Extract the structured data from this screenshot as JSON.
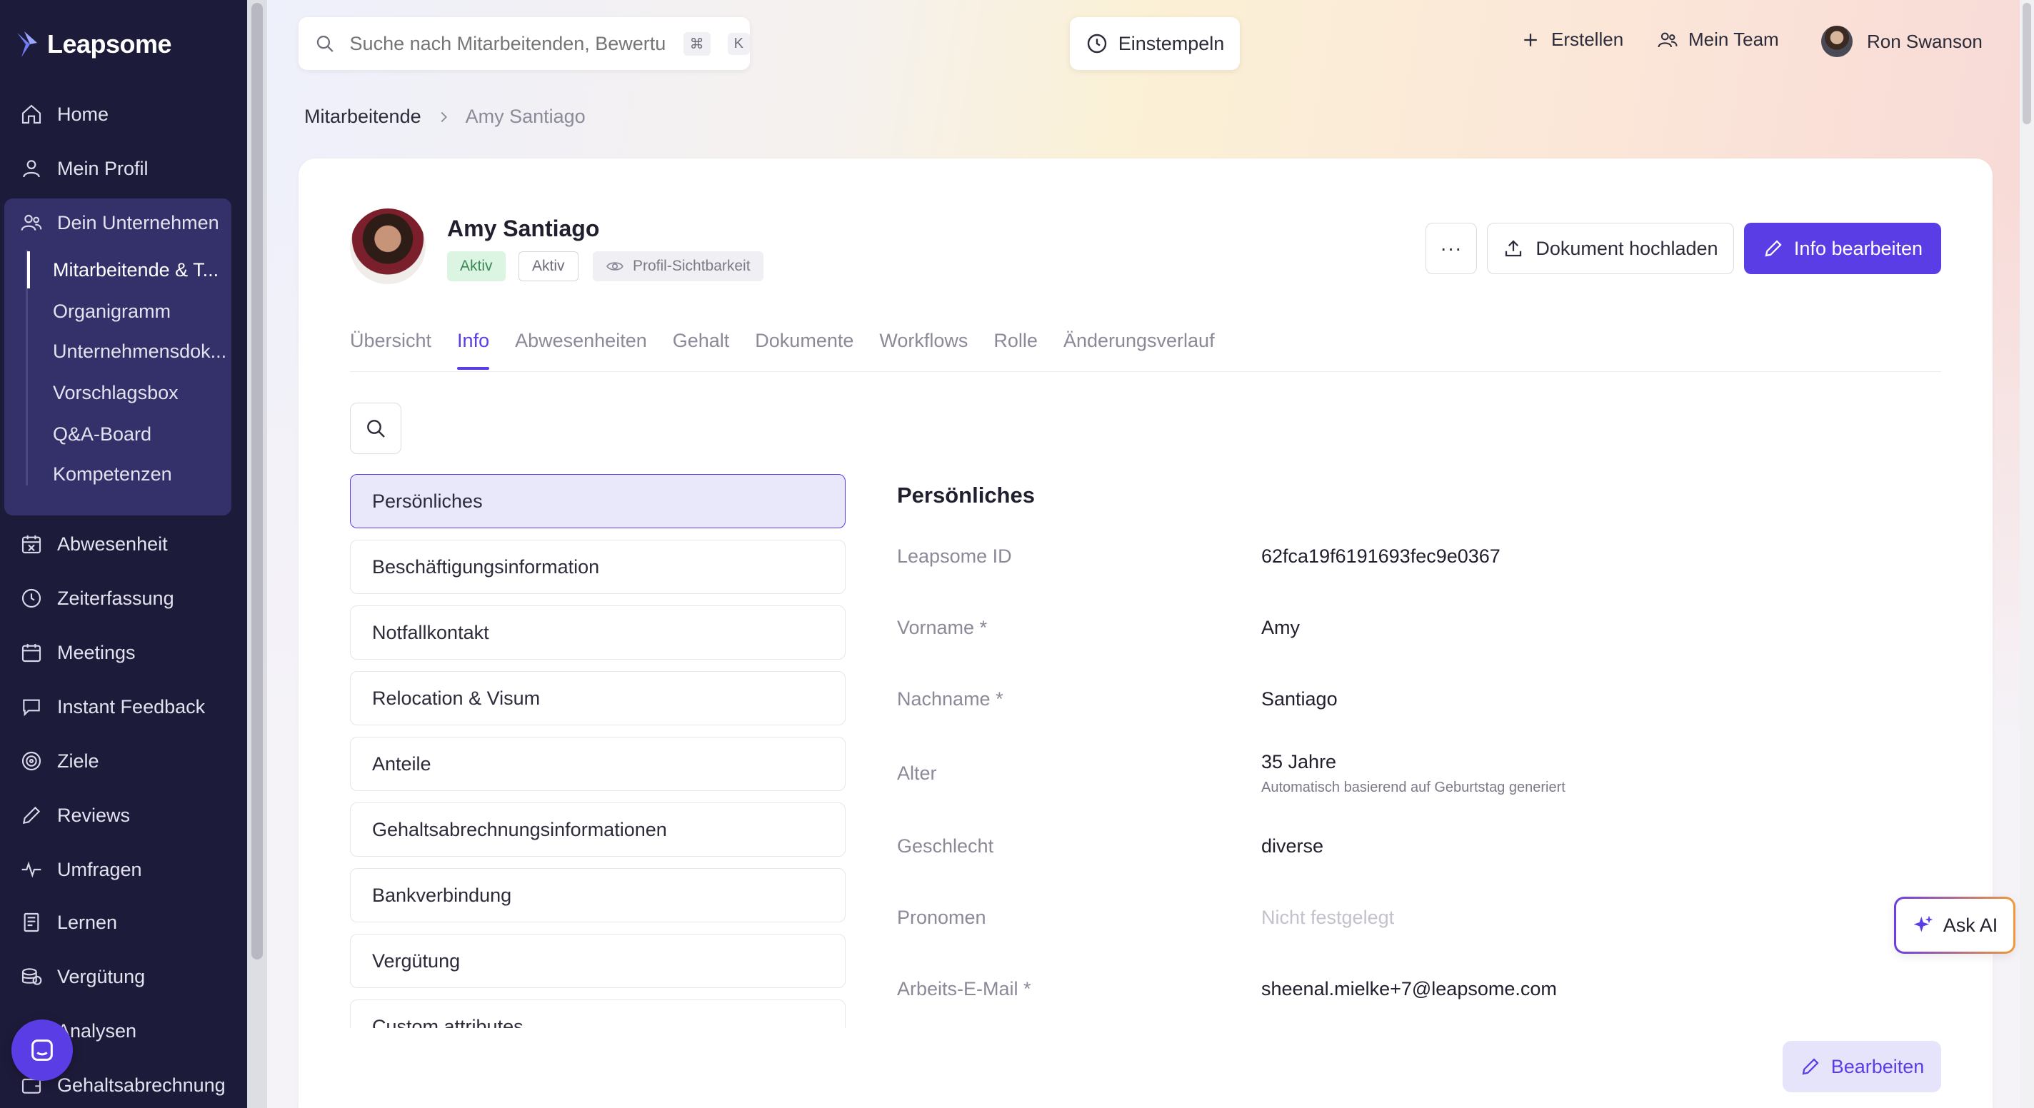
{
  "app": {
    "name": "Leapsome"
  },
  "sidebar": {
    "items": [
      {
        "label": "Home",
        "icon": "home-icon"
      },
      {
        "label": "Mein Profil",
        "icon": "user-icon"
      },
      {
        "label": "Dein Unternehmen",
        "icon": "users-icon"
      },
      {
        "label": "Abwesenheit",
        "icon": "calendar-x-icon"
      },
      {
        "label": "Zeiterfassung",
        "icon": "clock-icon"
      },
      {
        "label": "Meetings",
        "icon": "calendar-icon"
      },
      {
        "label": "Instant Feedback",
        "icon": "chat-icon"
      },
      {
        "label": "Ziele",
        "icon": "target-icon"
      },
      {
        "label": "Reviews",
        "icon": "pen-icon"
      },
      {
        "label": "Umfragen",
        "icon": "pulse-icon"
      },
      {
        "label": "Lernen",
        "icon": "book-icon"
      },
      {
        "label": "Vergütung",
        "icon": "coins-icon"
      },
      {
        "label": "Analysen",
        "icon": "chart-icon"
      },
      {
        "label": "Gehaltsabrechnung",
        "icon": "wallet-icon"
      }
    ],
    "subitems": [
      {
        "label": "Mitarbeitende & T..."
      },
      {
        "label": "Organigramm"
      },
      {
        "label": "Unternehmensdok..."
      },
      {
        "label": "Vorschlagsbox"
      },
      {
        "label": "Q&A-Board"
      },
      {
        "label": "Kompetenzen"
      }
    ]
  },
  "topbar": {
    "search_placeholder": "Suche nach Mitarbeitenden, Bewertungen",
    "shortcut_cmd": "⌘",
    "shortcut_key": "K",
    "clock_in": "Einstempeln",
    "create": "Erstellen",
    "my_team": "Mein Team",
    "user_name": "Ron Swanson"
  },
  "breadcrumb": {
    "parent": "Mitarbeitende",
    "current": "Amy Santiago"
  },
  "profile": {
    "name": "Amy Santiago",
    "badge_status": "Aktiv",
    "badge_outline": "Aktiv",
    "badge_visibility": "Profil-Sichtbarkeit",
    "more": "···",
    "upload_doc": "Dokument hochladen",
    "edit_info": "Info bearbeiten"
  },
  "tabs": [
    "Übersicht",
    "Info",
    "Abwesenheiten",
    "Gehalt",
    "Dokumente",
    "Workflows",
    "Rolle",
    "Änderungsverlauf"
  ],
  "active_tab": "Info",
  "sections": [
    "Persönliches",
    "Beschäftigungsinformation",
    "Notfallkontakt",
    "Relocation & Visum",
    "Anteile",
    "Gehaltsabrechnungsinformationen",
    "Bankverbindung",
    "Vergütung",
    "Custom attributes"
  ],
  "details": {
    "title": "Persönliches",
    "fields": [
      {
        "label": "Leapsome ID",
        "value": "62fca19f6191693fec9e0367"
      },
      {
        "label": "Vorname *",
        "value": "Amy"
      },
      {
        "label": "Nachname *",
        "value": "Santiago"
      },
      {
        "label": "Alter",
        "value": "35 Jahre",
        "hint": "Automatisch basierend auf Geburtstag generiert"
      },
      {
        "label": "Geschlecht",
        "value": "diverse"
      },
      {
        "label": "Pronomen",
        "value": "Nicht festgelegt"
      },
      {
        "label": "Arbeits-E-Mail *",
        "value": "sheenal.mielke+7@leapsome.com"
      }
    ]
  },
  "ask_ai": "Ask AI",
  "edit_button": "Bearbeiten",
  "colors": {
    "accent": "#5b3de6",
    "sidebar": "#1d1b3a",
    "active_badge": "#dcf4e2"
  }
}
